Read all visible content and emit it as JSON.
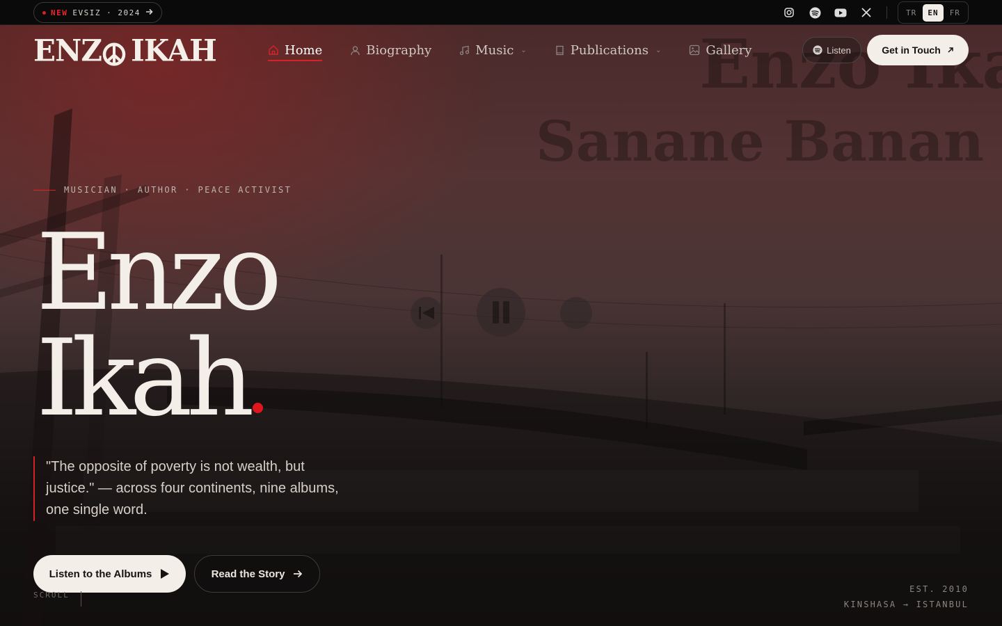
{
  "topbar": {
    "badge_new": "NEW",
    "badge_text": "EVSIZ · 2024",
    "socials": [
      "instagram-icon",
      "spotify-icon",
      "youtube-icon",
      "x-icon"
    ],
    "languages": [
      {
        "code": "TR",
        "active": false
      },
      {
        "code": "EN",
        "active": true
      },
      {
        "code": "FR",
        "active": false
      }
    ]
  },
  "brand": {
    "logo_left": "ENZ",
    "logo_right": "IKAH"
  },
  "nav": {
    "home": "Home",
    "biography": "Biography",
    "music": "Music",
    "publications": "Publications",
    "gallery": "Gallery",
    "listen": "Listen",
    "get_in_touch": "Get in Touch"
  },
  "background": {
    "ghost_line1": "Enzo Ika",
    "ghost_line2": "Sanane Banan"
  },
  "hero": {
    "eyebrow": "MUSICIAN · AUTHOR · PEACE ACTIVIST",
    "title_line1": "Enzo",
    "title_line2": "Ikah",
    "quote": "\"The opposite of poverty is not wealth, but justice.\" — across four continents, nine albums, one single word.",
    "cta_primary": "Listen to the Albums",
    "cta_secondary": "Read the Story",
    "scroll": "SCROLL",
    "est": "EST. 2010",
    "route": "KINSHASA → ISTANBUL"
  },
  "colors": {
    "accent": "#d8222a",
    "cream": "#f3eee7",
    "dark": "#0f0d0d"
  }
}
